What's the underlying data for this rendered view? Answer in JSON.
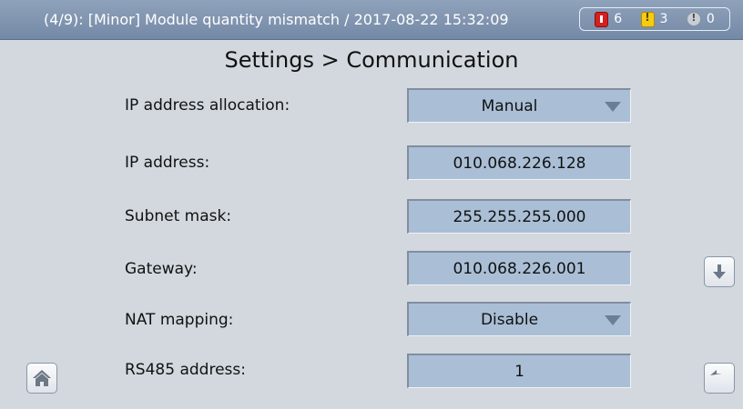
{
  "status_bar": {
    "alarm_message": "(4/9): [Minor] Module quantity mismatch / 2017-08-22 15:32:09",
    "counters": {
      "critical": "6",
      "minor": "3",
      "warning": "0"
    }
  },
  "page_title": "Settings > Communication",
  "fields": [
    {
      "label": "IP address allocation:",
      "value": "Manual"
    },
    {
      "label": "IP address:",
      "value": "010.068.226.128"
    },
    {
      "label": "Subnet mask:",
      "value": "255.255.255.000"
    },
    {
      "label": "Gateway:",
      "value": "010.068.226.001"
    },
    {
      "label": "NAT mapping:",
      "value": "Disable"
    },
    {
      "label": "RS485 address:",
      "value": "1"
    }
  ],
  "icons": {
    "home": "home-icon",
    "scroll_down": "arrow-down-icon",
    "back": "back-icon"
  },
  "colors": {
    "status_bar": "#7f93ae",
    "background": "#d2d8de",
    "field": "#aabfd6",
    "critical": "#d61f1f",
    "minor": "#f4cc12"
  }
}
